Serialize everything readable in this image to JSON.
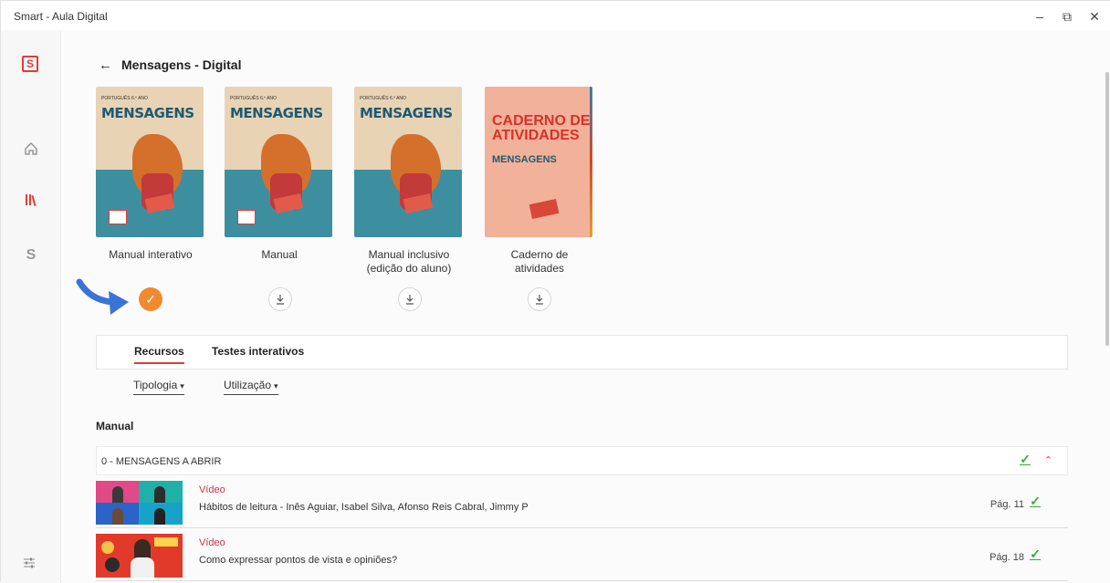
{
  "window": {
    "title": "Smart - Aula Digital",
    "controls": {
      "minimize": "–",
      "restore": "⧉",
      "close": "✕"
    }
  },
  "sidebar": {
    "logo_letter": "S",
    "items": [
      {
        "icon": "home-icon"
      },
      {
        "icon": "library-icon"
      },
      {
        "icon": "smart-s-icon",
        "letter": "S"
      }
    ]
  },
  "header": {
    "back": "←",
    "title": "Mensagens - Digital"
  },
  "books": [
    {
      "label": "Manual interativo",
      "cover_title": "MENSAGENS",
      "cover_small": "PORTUGUÊS 6.º ANO",
      "status": "downloaded"
    },
    {
      "label": "Manual",
      "cover_title": "MENSAGENS",
      "cover_small": "PORTUGUÊS 6.º ANO",
      "status": "download"
    },
    {
      "label": "Manual inclusivo (edição do aluno)",
      "cover_title": "MENSAGENS",
      "cover_small": "PORTUGUÊS 6.º ANO",
      "status": "download"
    },
    {
      "label": "Caderno de atividades",
      "cover_title": "CADERNO DE ATIVIDADES",
      "cover_sub": "MENSAGENS",
      "status": "download"
    }
  ],
  "tabs": [
    {
      "label": "Recursos",
      "active": true
    },
    {
      "label": "Testes interativos",
      "active": false
    }
  ],
  "filters": [
    {
      "label": "Tipologia"
    },
    {
      "label": "Utilização"
    }
  ],
  "section": {
    "title": "Manual"
  },
  "group": {
    "label": "0 - MENSAGENS A ABRIR",
    "collapse_icon": "chevron-up-icon"
  },
  "resources": [
    {
      "type": "Vídeo",
      "title": "Hábitos de leitura - Inês Aguiar, Isabel Silva, Afonso Reis Cabral, Jimmy P",
      "page": "Pág. 11"
    },
    {
      "type": "Vídeo",
      "title": "Como expressar pontos de vista e opiniões?",
      "page": "Pág. 18"
    }
  ],
  "colors": {
    "accent": "#e23b3b",
    "orange": "#f08a30",
    "check": "#3aa83a",
    "resource_type": "#c8344a"
  }
}
